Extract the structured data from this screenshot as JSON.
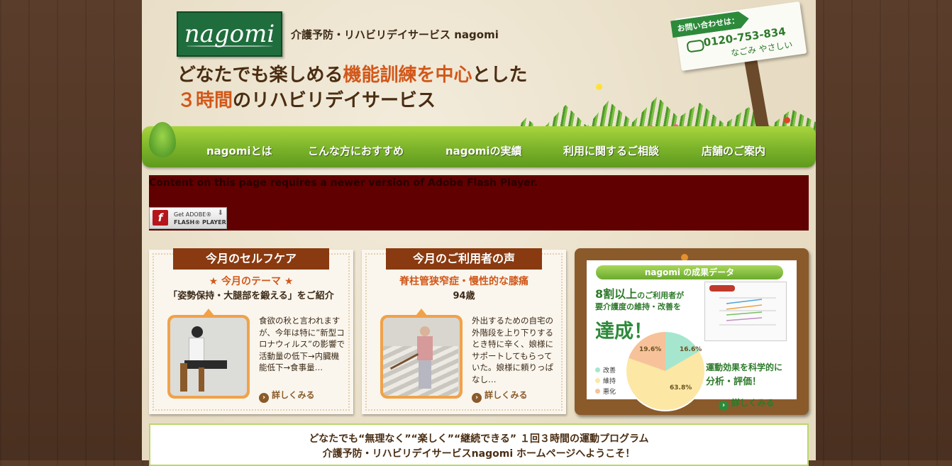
{
  "header": {
    "logo_text": "nagomi",
    "site_name": "介護予防・リハビリデイサービス nagomi",
    "headline_a": "どなたでも楽しめる",
    "headline_b": "機能訓練を中心",
    "headline_c": "とした",
    "headline_d": "３時間",
    "headline_e": "のリハビリデイサービス",
    "contact_tag": "お問い合わせは：",
    "contact_phone": "0120-753-834",
    "contact_reading": "なごみ やさしい"
  },
  "nav": [
    {
      "label": "nagomiとは"
    },
    {
      "label": "こんな方におすすめ"
    },
    {
      "label": "nagomiの実績"
    },
    {
      "label": "利用に関するご相談"
    },
    {
      "label": "店舗のご案内"
    }
  ],
  "flash": {
    "message": "Content on this page requires a newer version of Adobe Flash Player.",
    "button_line1": "Get ADOBE®",
    "button_line2": "FLASH® PLAYER"
  },
  "selfcare": {
    "title": "今月のセルフケア",
    "theme": "★ 今月のテーマ ★",
    "subtitle": "「姿勢保持・大腿部を鍛える」をご紹介",
    "text": "食欲の秋と言われますが、今年は特に”新型コロナウィルス”の影響で活動量の低下→内臓機能低下→食事量…",
    "more": "詳しくみる"
  },
  "voice": {
    "title": "今月のご利用者の声",
    "condition": "脊柱管狭窄症・慢性的な膝痛",
    "age": "94歳",
    "text": "外出するための自宅の外階段を上り下りするとき特に辛く、娘様にサポートしてもらっていた。娘様に頼りっぱなし…",
    "more": "詳しくみる"
  },
  "results": {
    "title": "nagomi の成果データ",
    "line1_big": "8割以上",
    "line1_rest": "のご利用者が",
    "line2": "要介護度の維持・改善を",
    "line3": "達成！",
    "right1": "運動効果を科学的に",
    "right2": "分析・評価！",
    "more": "詳しくみる",
    "legend": [
      {
        "label": "改善",
        "color": "#a6e6cf"
      },
      {
        "label": "維持",
        "color": "#fce7a5"
      },
      {
        "label": "悪化",
        "color": "#f7c29a"
      }
    ],
    "pie_labels": [
      "16.6%",
      "63.8%",
      "19.6%"
    ]
  },
  "welcome": {
    "line1": "どなたでも“無理なく”“楽しく”“継続できる” １回３時間の運動プログラム",
    "line2": "介護予防・リハビリデイサービスnagomi ホームページへようこそ！"
  }
}
